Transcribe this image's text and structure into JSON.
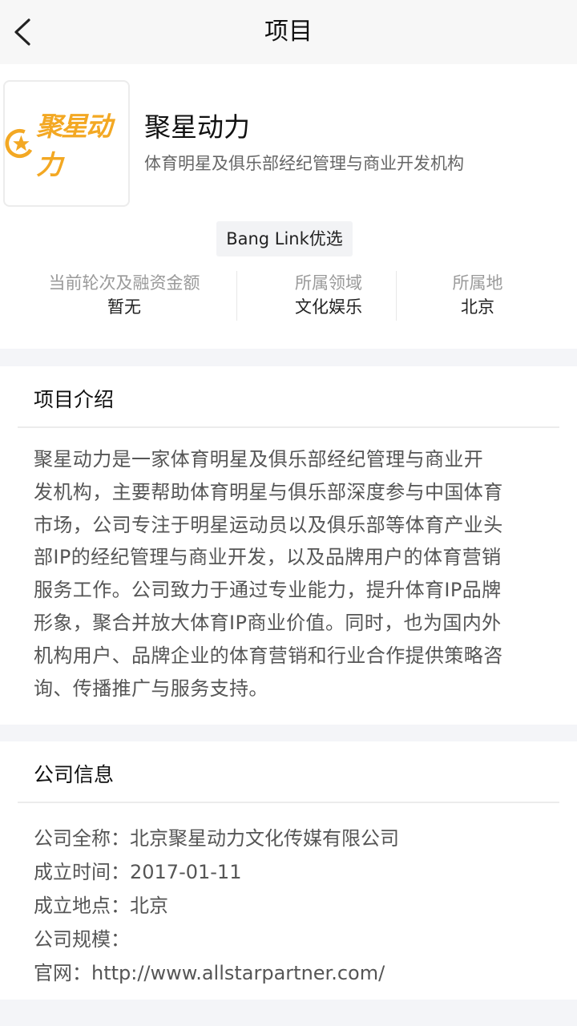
{
  "header": {
    "title": "项目"
  },
  "project": {
    "logo_text": "聚星动力",
    "name": "聚星动力",
    "description": "体育明星及俱乐部经纪管理与商业开发机构",
    "tag": "Bang Link优选",
    "stats": [
      {
        "label": "当前轮次及融资金额",
        "value": "暂无"
      },
      {
        "label": "所属领域",
        "value": "文化娱乐"
      },
      {
        "label": "所属地",
        "value": "北京"
      }
    ]
  },
  "intro": {
    "title": "项目介绍",
    "lines": [
      "聚星动力是一家体育明星及俱乐部经纪管理与商业开",
      "发机构，主要帮助体育明星与俱乐部深度参与中国体育",
      "市场，公司专注于明星运动员以及俱乐部等体育产业头",
      "部IP的经纪管理与商业开发，以及品牌用户的体育营销",
      "服务工作。公司致力于通过专业能力，提升体育IP品牌",
      "形象，聚合并放大体育IP商业价值。同时，也为国内外",
      "机构用户、品牌企业的体育营销和行业合作提供策略咨",
      "询、传播推广与服务支持。"
    ]
  },
  "company": {
    "title": "公司信息",
    "rows": [
      "公司全称：北京聚星动力文化传媒有限公司",
      "成立时间：2017-01-11",
      "成立地点：北京",
      "公司规模：",
      "官网：http://www.allstarpartner.com/"
    ]
  },
  "colors": {
    "brand": "#f3a823",
    "background": "#f4f5f8"
  },
  "icons": {
    "back": "chevron-left-icon",
    "logo_star": "star-icon"
  }
}
